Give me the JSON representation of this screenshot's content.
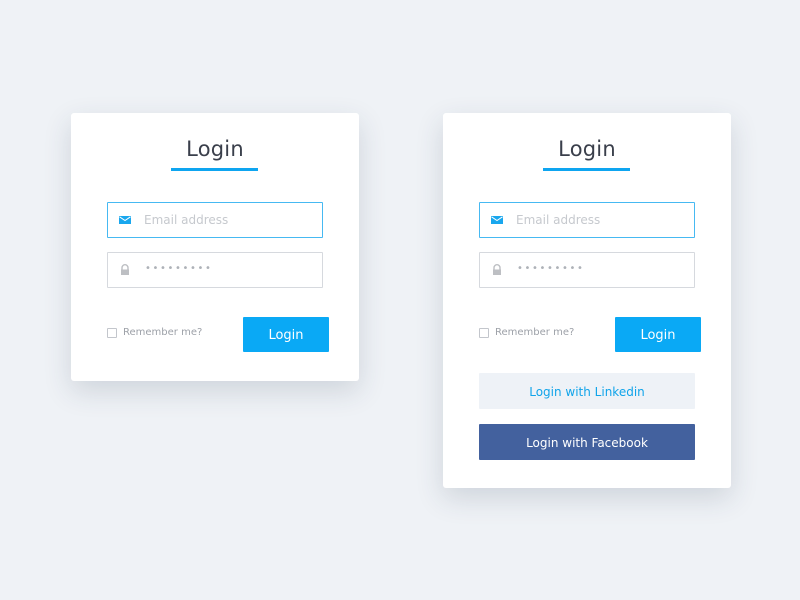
{
  "colors": {
    "background": "#eff2f6",
    "accent": "#0aa9f5",
    "facebook": "#43619e",
    "linkedin_bg": "#eef2f7"
  },
  "cards": [
    {
      "title": "Login",
      "email": {
        "placeholder": "Email address",
        "icon": "mail-icon"
      },
      "password": {
        "value_masked": "•••••••••",
        "icon": "lock-icon"
      },
      "remember_label": "Remember me?",
      "login_label": "Login"
    },
    {
      "title": "Login",
      "email": {
        "placeholder": "Email address",
        "icon": "mail-icon"
      },
      "password": {
        "value_masked": "•••••••••",
        "icon": "lock-icon"
      },
      "remember_label": "Remember me?",
      "login_label": "Login",
      "linkedin_label": "Login with Linkedin",
      "facebook_label": "Login with Facebook"
    }
  ]
}
